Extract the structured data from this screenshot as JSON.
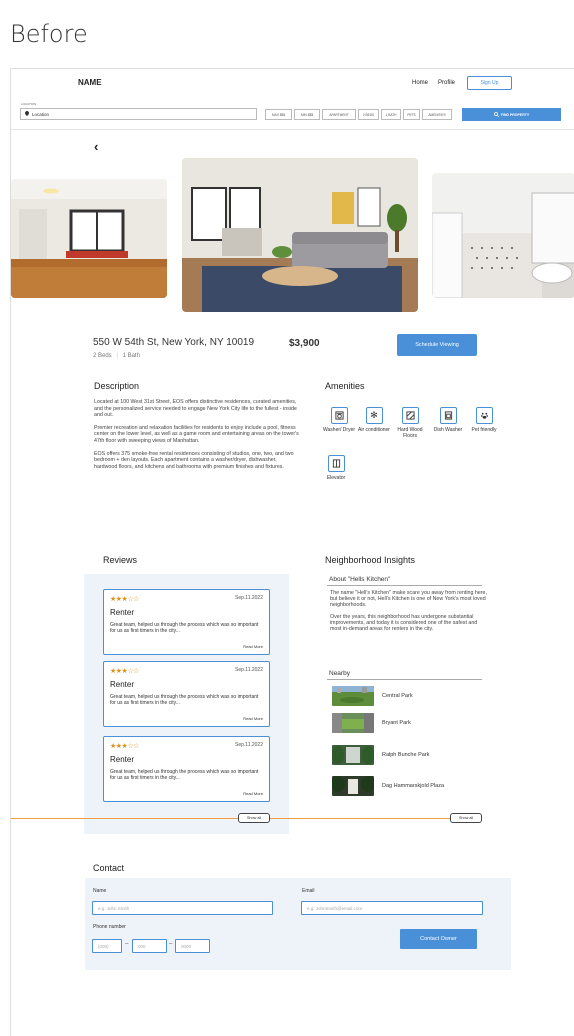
{
  "caption": "Before",
  "header": {
    "brand": "NAME",
    "nav": [
      "Home",
      "Profile"
    ],
    "signup_label": "Sign Up"
  },
  "search": {
    "location_label": "LOCATION",
    "location_value": "Location",
    "filters": [
      "MAX $$$",
      "MIN $$$",
      "APARTMENT",
      "2 BEDS",
      "1 BATH",
      "PETS",
      "AMENITIES"
    ],
    "find_label": "FIND PROPERTY"
  },
  "listing": {
    "address": "550 W 54th St, New York, NY 10019",
    "beds": "2 Beds",
    "baths": "1 Bath",
    "price": "$3,900",
    "schedule_label": "Schedule Viewing"
  },
  "description": {
    "title": "Description",
    "paragraphs": [
      "Located at 100 West 31st Street, EOS offers distinctive residences, curated amenities, and the personalized service needed to engage New York City life to the fullest - inside and out.",
      "Premier recreation and relaxation facilities for residents to enjoy include a pool, fitness center on the lower level, as well as a game room and entertaining areas on the tower's 47th floor with sweeping views of Manhattan.",
      "EOS offers 375 smoke-free rental residences consisting of studios, one, two, and two bedroom + den layouts. Each apartment contains a washer/dryer, dishwasher, hardwood floors, and kitchens and bathrooms with premium finishes and fixtures."
    ]
  },
  "amenities": {
    "title": "Amenities",
    "items": [
      {
        "label": "Washer/ Dryer",
        "icon": "washer-icon"
      },
      {
        "label": "Air conditioner",
        "icon": "snowflake-icon"
      },
      {
        "label": "Hard Wood Floors",
        "icon": "floor-icon"
      },
      {
        "label": "Dish Washer",
        "icon": "dishwasher-icon"
      },
      {
        "label": "Pet friendly",
        "icon": "paw-icon"
      },
      {
        "label": "Elevator",
        "icon": "elevator-icon"
      }
    ]
  },
  "reviews": {
    "title": "Reviews",
    "items": [
      {
        "stars": "★★★☆☆",
        "date": "Sep.11.2022",
        "name": "Renter",
        "text": "Great team, helped us through the process which was so important for us as first timers in the city...",
        "more": "Read More"
      },
      {
        "stars": "★★★☆☆",
        "date": "Sep.11.2022",
        "name": "Renter",
        "text": "Great team, helped us through the process which was so important for us as first timers in the city...",
        "more": "Read More"
      },
      {
        "stars": "★★★☆☆",
        "date": "Sep.11.2022",
        "name": "Renter",
        "text": "Great team, helped us through the process which was so important for us as first timers in the city...",
        "more": "Read More"
      }
    ],
    "show_all": "Show all"
  },
  "neighborhood": {
    "title": "Neighborhood Insights",
    "about_title": "About \"Hells Kitchen\"",
    "paragraphs": [
      "The name \"Hell's Kitchen\" make scare you away from renting here, but believe it or not, Hell's Kitchen is one of New York's most loved neighborhoods.",
      "Over the years, this neighborhood has undergone substantial improvements, and today it is considered one of the safest and most in-demand areas for renters in the city."
    ],
    "nearby_title": "Nearby",
    "nearby": [
      "Central Park",
      "Bryant Park",
      "Ralph Bunche Park",
      "Dag Hammarskjold Plaza"
    ],
    "show_all": "Show all"
  },
  "contact": {
    "title": "Contact",
    "name_label": "Name",
    "name_placeholder": "e.g. John Smith",
    "email_label": "Email",
    "email_placeholder": "e.g. JohnSmith@email.com",
    "phone_label": "Phone number",
    "phone_placeholders": [
      "(000)",
      "000",
      "0000"
    ],
    "button_label": "Contact Owner"
  },
  "colors": {
    "accent": "#4a90d9",
    "panel": "#eef3f9",
    "stars": "#d9921c",
    "annotation_line": "#f0a040"
  }
}
